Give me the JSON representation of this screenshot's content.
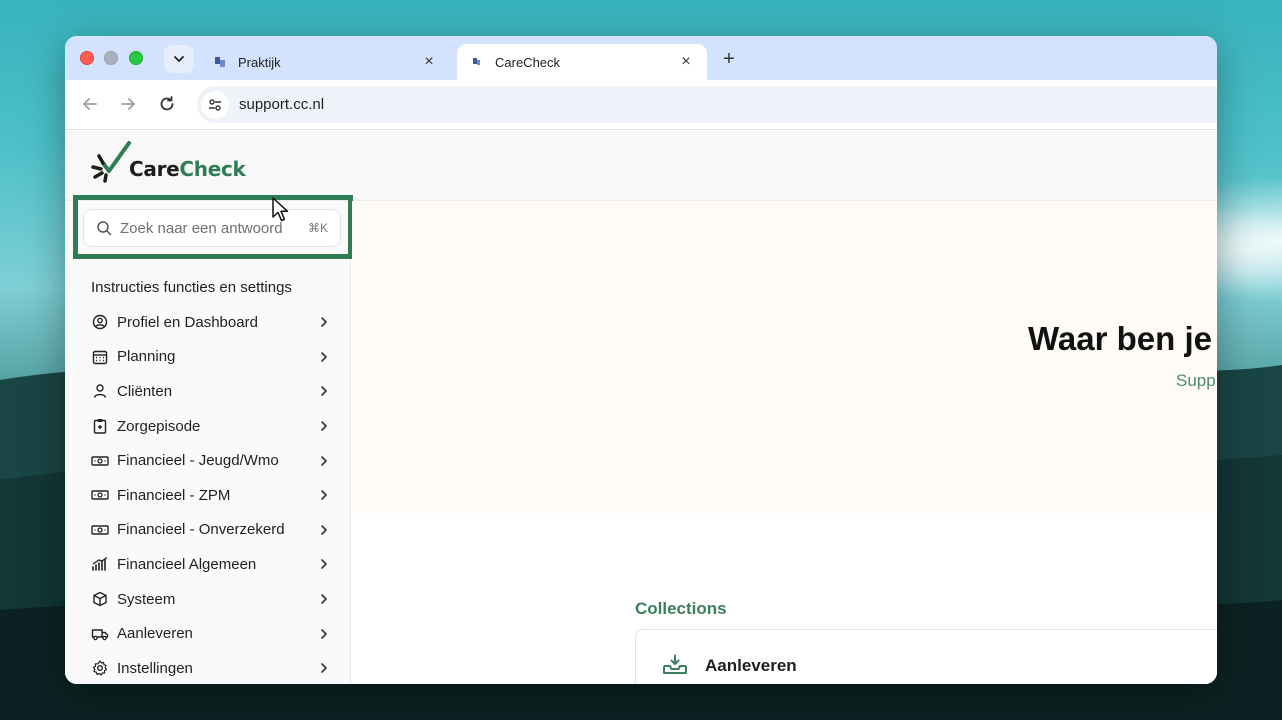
{
  "browser": {
    "tabs": [
      {
        "title": "Praktijk",
        "close": "×"
      },
      {
        "title": "CareCheck",
        "close": "×"
      }
    ],
    "new_tab": "+",
    "url": "support.cc.nl"
  },
  "site": {
    "logo_part1": "Care",
    "logo_part2": "Check",
    "brand_color": "#2f7d55"
  },
  "sidebar": {
    "search": {
      "placeholder": "Zoek naar een antwoord",
      "shortcut": "⌘K"
    },
    "section_title": "Instructies functies en settings",
    "items": [
      {
        "label": "Profiel en Dashboard",
        "icon": "user-circle-icon"
      },
      {
        "label": "Planning",
        "icon": "calendar-icon"
      },
      {
        "label": "Cliënten",
        "icon": "user-icon"
      },
      {
        "label": "Zorgepisode",
        "icon": "clipboard-icon"
      },
      {
        "label": "Financieel - Jeugd/Wmo",
        "icon": "banknote-icon"
      },
      {
        "label": "Financieel - ZPM",
        "icon": "banknote-icon"
      },
      {
        "label": "Financieel - Onverzekerd",
        "icon": "banknote-icon"
      },
      {
        "label": "Financieel Algemeen",
        "icon": "chart-bars-icon"
      },
      {
        "label": "Systeem",
        "icon": "cube-icon"
      },
      {
        "label": "Aanleveren",
        "icon": "truck-icon"
      },
      {
        "label": "Instellingen",
        "icon": "gear-icon"
      }
    ]
  },
  "hero": {
    "title": "Waar ben je",
    "subtitle": "Supp"
  },
  "collections": {
    "label": "Collections",
    "cards": [
      {
        "title": "Aanleveren",
        "icon": "inbox-download-icon"
      }
    ]
  }
}
